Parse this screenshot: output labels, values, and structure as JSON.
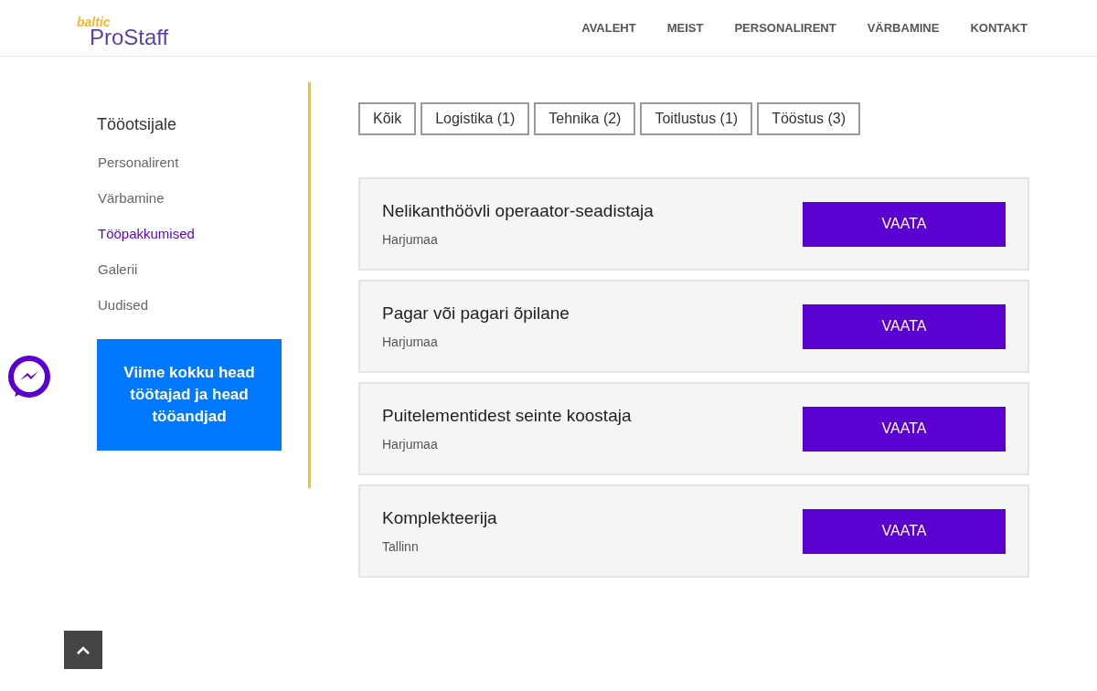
{
  "logo": {
    "small": "baltic",
    "main": "ProStaff"
  },
  "nav": [
    "AVALEHT",
    "MEIST",
    "PERSONALIRENT",
    "VÄRBAMINE",
    "KONTAKT"
  ],
  "sidebar": {
    "title": "Tööotsijale",
    "items": [
      {
        "label": "Personalirent",
        "selected": false
      },
      {
        "label": "Värbamine",
        "selected": false
      },
      {
        "label": "Tööpakkumised",
        "selected": true
      },
      {
        "label": "Galerii",
        "selected": false
      },
      {
        "label": "Uudised",
        "selected": false
      }
    ],
    "banner": "Viime kokku head töötajad ja head tööandjad"
  },
  "filters": [
    "Kõik",
    "Logistika (1)",
    "Tehnika (2)",
    "Toitlustus (1)",
    "Tööstus (3)"
  ],
  "jobs": [
    {
      "title": "Nelikanthöövli operaator-seadistaja",
      "location": "Harjumaa",
      "button": "VAATA"
    },
    {
      "title": "Pagar või pagari õpilane",
      "location": "Harjumaa",
      "button": "VAATA"
    },
    {
      "title": "Puitelementidest seinte koostaja",
      "location": "Harjumaa",
      "button": "VAATA"
    },
    {
      "title": "Komplekteerija",
      "location": "Tallinn",
      "button": "VAATA"
    }
  ]
}
